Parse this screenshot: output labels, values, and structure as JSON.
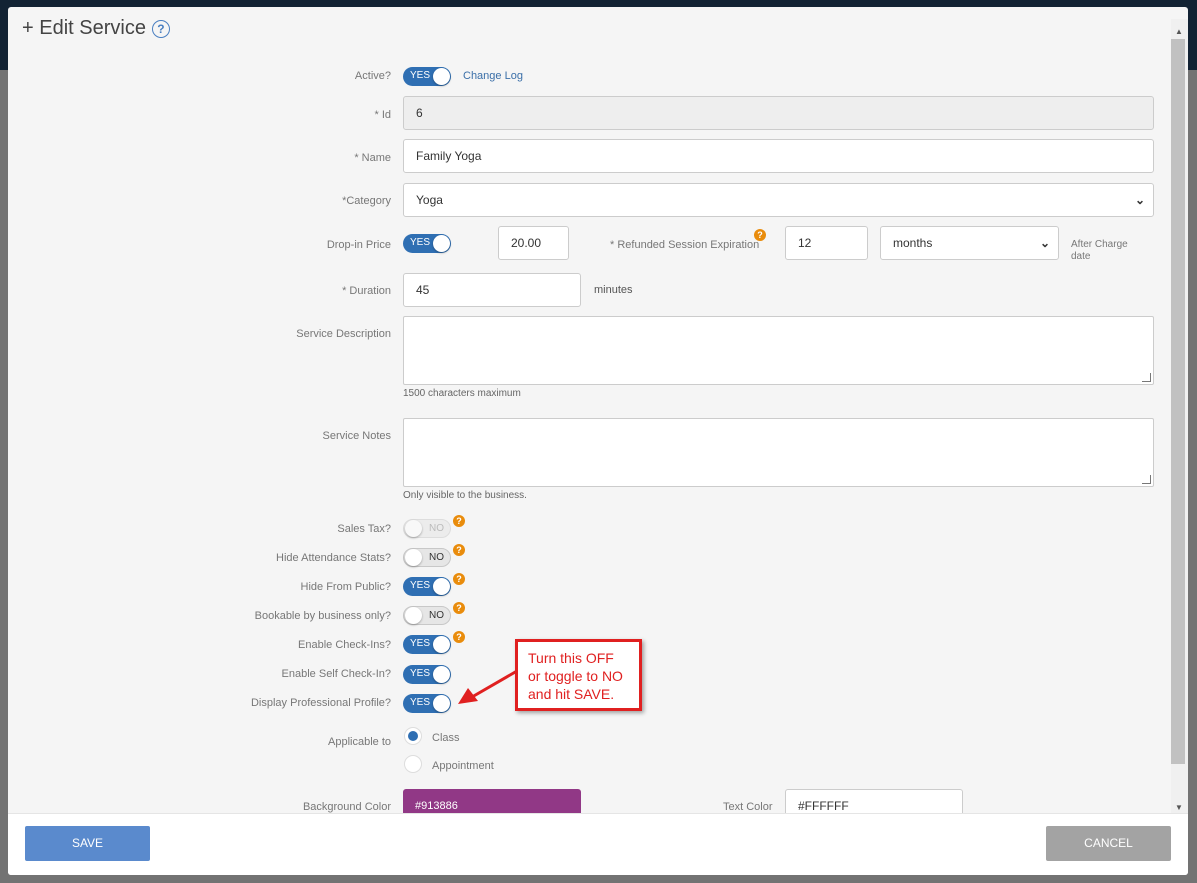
{
  "modal": {
    "title": "+ Edit Service",
    "help_icon": "?"
  },
  "fields": {
    "active": {
      "label": "Active?",
      "toggle": "YES",
      "link": "Change Log"
    },
    "id": {
      "label": "* Id",
      "value": "6"
    },
    "name": {
      "label": "* Name",
      "value": "Family Yoga"
    },
    "category": {
      "label": "*Category",
      "value": "Yoga"
    },
    "drop_in_price": {
      "label": "Drop-in Price",
      "toggle": "YES",
      "value": "20.00"
    },
    "refunded_session_expiration": {
      "label": "* Refunded Session Expiration",
      "value": "12",
      "unit": "months",
      "suffix_line1": "After Charge",
      "suffix_line2": "date"
    },
    "duration": {
      "label": "* Duration",
      "value": "45",
      "unit": "minutes"
    },
    "service_description": {
      "label": "Service Description",
      "hint": "1500 characters maximum"
    },
    "service_notes": {
      "label": "Service Notes",
      "hint": "Only visible to the business."
    },
    "sales_tax": {
      "label": "Sales Tax?",
      "toggle": "NO"
    },
    "hide_attendance_stats": {
      "label": "Hide Attendance Stats?",
      "toggle": "NO"
    },
    "hide_from_public": {
      "label": "Hide From Public?",
      "toggle": "YES"
    },
    "bookable_by_business_only": {
      "label": "Bookable by business only?",
      "toggle": "NO"
    },
    "enable_check_ins": {
      "label": "Enable Check-Ins?",
      "toggle": "YES"
    },
    "enable_self_check_in": {
      "label": "Enable Self Check-In?",
      "toggle": "YES"
    },
    "display_professional_profile": {
      "label": "Display Professional Profile?",
      "toggle": "YES"
    },
    "applicable_to": {
      "label": "Applicable to",
      "options": [
        "Class",
        "Appointment"
      ],
      "selected": "Class"
    },
    "background_color": {
      "label": "Background Color",
      "value": "#913886"
    },
    "text_color": {
      "label": "Text Color",
      "value": "#FFFFFF"
    }
  },
  "callout": {
    "line1": "Turn this OFF",
    "line2": "or toggle to NO",
    "line3": "and hit SAVE."
  },
  "footer": {
    "save": "SAVE",
    "cancel": "CANCEL"
  },
  "colors": {
    "toggle_on": "#2f6fb3",
    "help": "#e98c0c",
    "save": "#5a8acd",
    "cancel": "#a3a3a3",
    "callout": "#e02020",
    "swatch": "#913886"
  }
}
